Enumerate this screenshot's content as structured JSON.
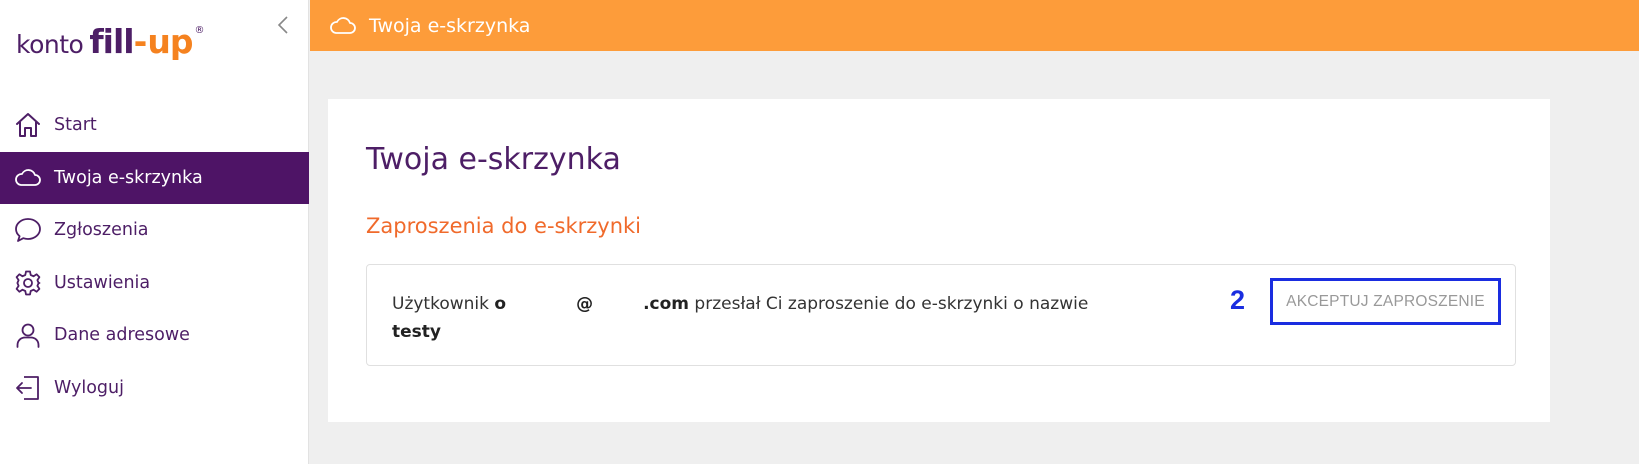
{
  "logo": {
    "prefix": "konto",
    "fill": "fill",
    "dash": "-",
    "up": "up",
    "reg": "®"
  },
  "sidebar": {
    "items": [
      {
        "label": "Start",
        "icon": "home-icon"
      },
      {
        "label": "Twoja e-skrzynka",
        "icon": "cloud-icon",
        "active": true
      },
      {
        "label": "Zgłoszenia",
        "icon": "chat-bubble-icon"
      },
      {
        "label": "Ustawienia",
        "icon": "gear-icon"
      },
      {
        "label": "Dane adresowe",
        "icon": "user-icon"
      },
      {
        "label": "Wyloguj",
        "icon": "logout-icon"
      }
    ]
  },
  "header": {
    "title": "Twoja e-skrzynka",
    "icon": "cloud-icon"
  },
  "main": {
    "page_title": "Twoja e-skrzynka",
    "section_title": "Zaproszenia do e-skrzynki",
    "invite": {
      "prefix": "Użytkownik",
      "email_start": "o",
      "email_at": "@",
      "email_domain": ".com",
      "middle": "przesłał Ci zaproszenie do e-skrzynki o nazwie",
      "mailbox_name": "testy",
      "step_number": "2",
      "accept_label": "AKCEPTUJ ZAPROSZENIE"
    }
  },
  "colors": {
    "brand_purple": "#4e1466",
    "brand_orange": "#fd9c3a",
    "section_orange": "#f06a2b",
    "highlight_blue": "#1a2de0"
  }
}
